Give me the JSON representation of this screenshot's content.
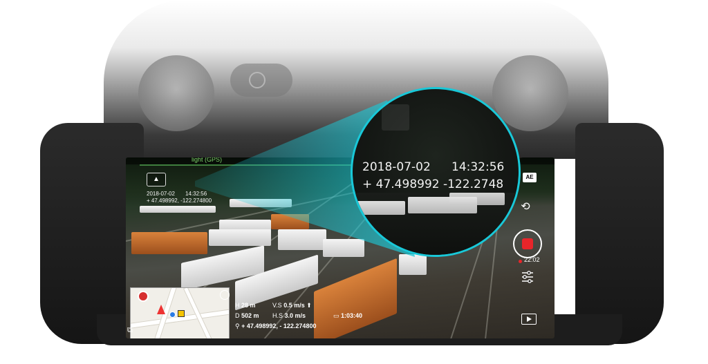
{
  "screen": {
    "top_bar_label": "light (GPS)",
    "camera_mode_icon": "aircraft-mode-icon",
    "overlay": {
      "date": "2018-07-02",
      "time": "14:32:56",
      "coords": "+ 47.498992, -122.274800"
    },
    "right_controls": {
      "ae_label": "AE",
      "record_time": "22:02",
      "icons": [
        "switch-camera-icon",
        "record-icon",
        "settings-sliders-icon",
        "playback-icon"
      ]
    },
    "telemetry": {
      "h_label": "H",
      "h_value": "28 m",
      "vs_label": "V.S",
      "vs_value": "0.5 m/s",
      "d_label": "D",
      "d_value": "502 m",
      "hs_label": "H.S",
      "hs_value": "3.0 m/s",
      "flight_time": "1:03:40",
      "gps": "+ 47.498992, - 122.274800"
    }
  },
  "magnifier": {
    "date": "2018-07-02",
    "time": "14:32:56",
    "coords": "+ 47.498992   -122.2748"
  },
  "colors": {
    "lens_border": "#19c8d8",
    "record": "#e8252a",
    "beam": "#1ec6d4"
  }
}
